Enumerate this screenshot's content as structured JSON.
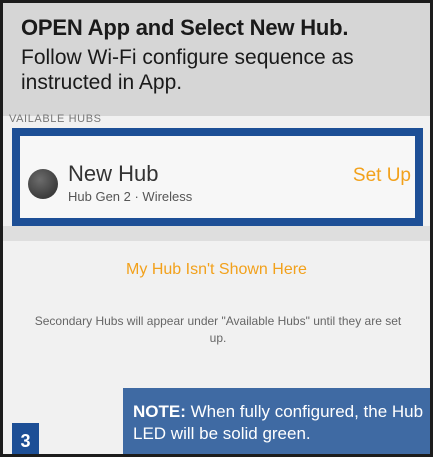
{
  "banner": {
    "headline": "OPEN App and Select New Hub.",
    "instructions": "Follow Wi-Fi configure sequence as instructed in App."
  },
  "section_label": "VAILABLE HUBS",
  "hub": {
    "name": "New Hub",
    "subtitle": "Hub Gen 2 · Wireless",
    "setup_label": "Set Up",
    "icon": "hub-device-icon"
  },
  "missing_link": "My Hub Isn't Shown Here",
  "secondary_info": "Secondary Hubs will appear under \"Available Hubs\" until they are set up.",
  "note": {
    "label": "NOTE:",
    "text": "When fully configured, the Hub LED will be solid green."
  },
  "step_number": "3",
  "colors": {
    "accent": "#f2a11b",
    "highlight_border": "#1d4f96",
    "note_background": "#3f6aa3"
  }
}
